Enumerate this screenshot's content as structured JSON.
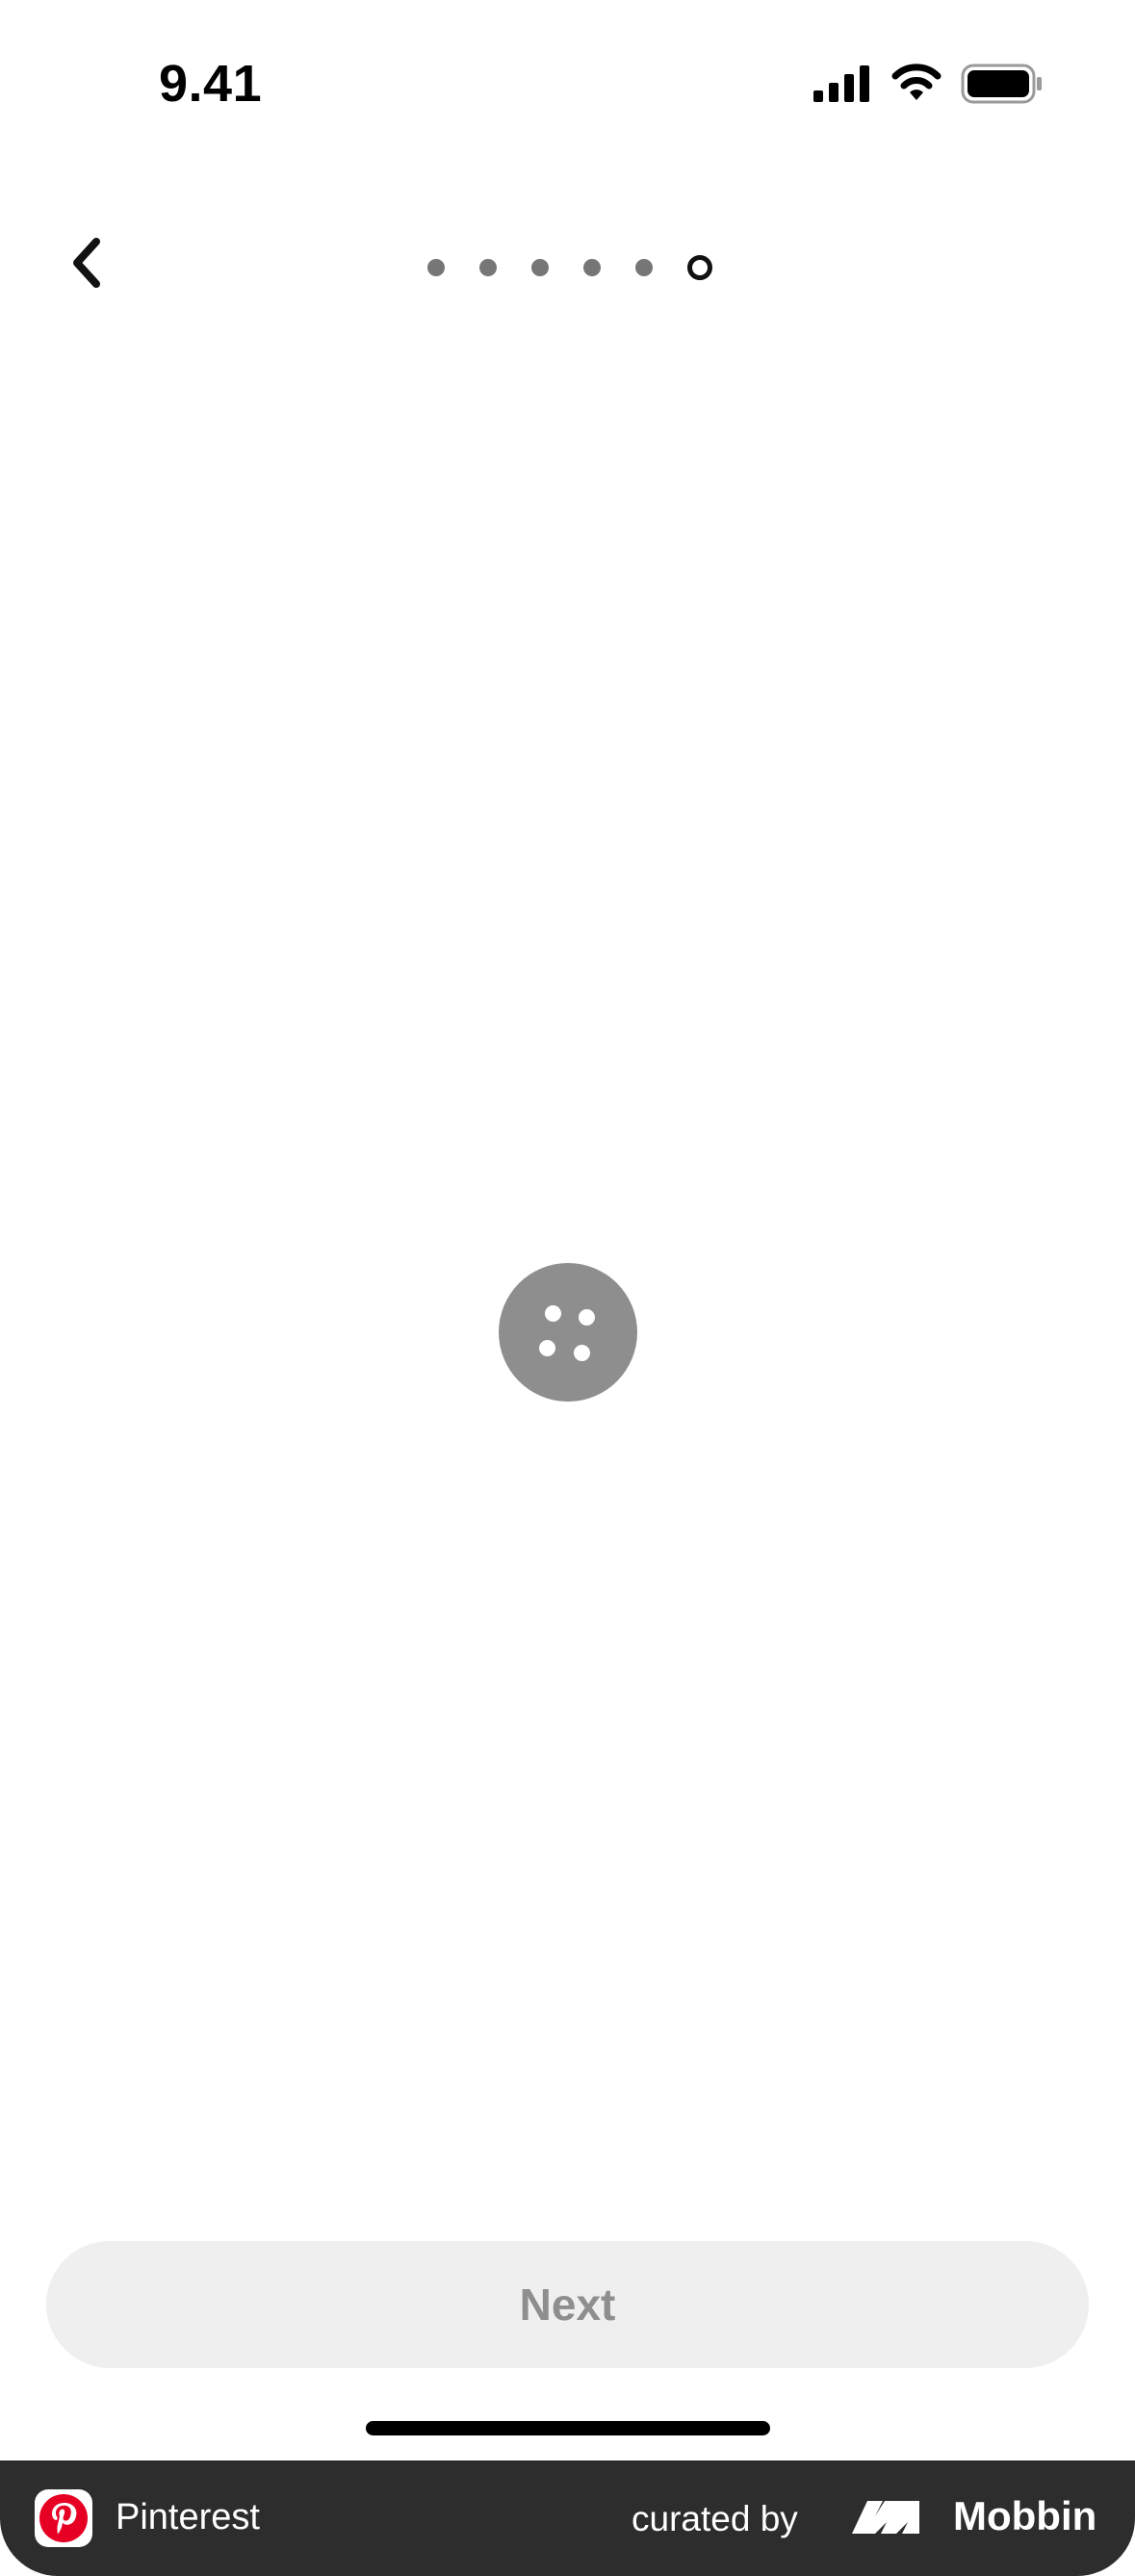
{
  "status_bar": {
    "time": "9.41",
    "icons": [
      "signal-icon",
      "wifi-icon",
      "battery-icon"
    ]
  },
  "nav": {
    "back_icon": "chevron-left-icon",
    "progress": {
      "total_steps": 6,
      "current_step": 6
    }
  },
  "main": {
    "loading_icon": "pinterest-loading-spinner-icon"
  },
  "actions": {
    "next_label": "Next",
    "next_enabled": false
  },
  "footer": {
    "app_name": "Pinterest",
    "curated_label": "curated by",
    "brand_name": "Mobbin",
    "app_color": "#E60023",
    "background": "#2D2D2D"
  }
}
